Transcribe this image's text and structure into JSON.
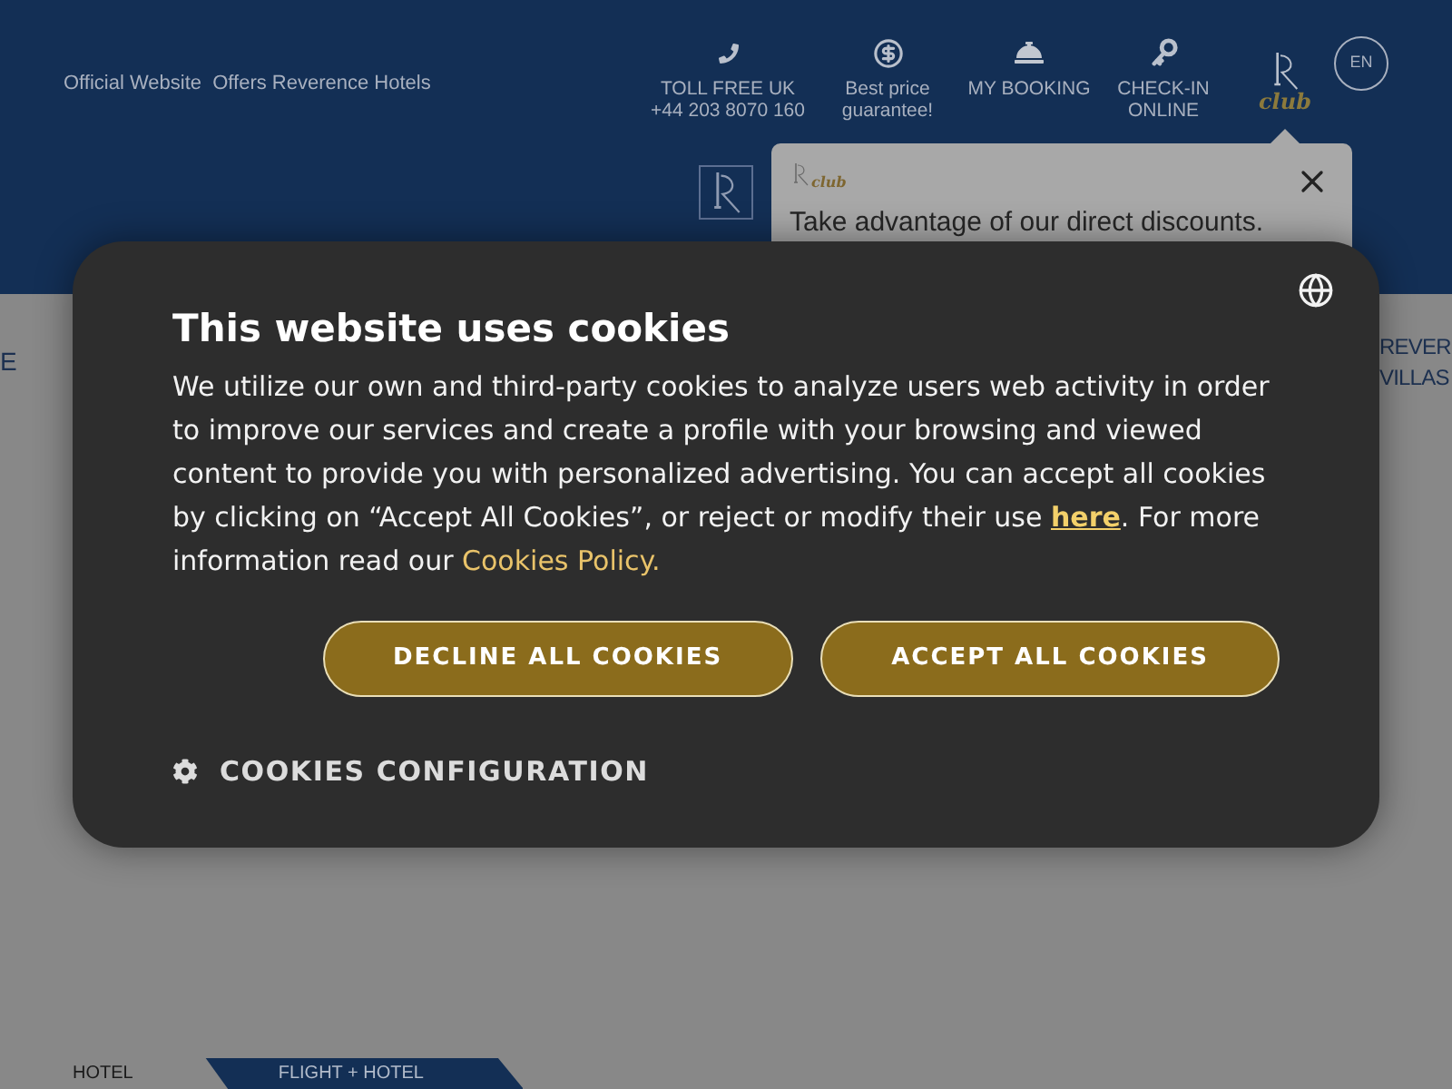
{
  "header": {
    "tagline": "Official Website  Offers Reverence Hotels",
    "links": [
      {
        "kind": "phone",
        "lines": [
          "TOLL FREE UK",
          "+44 203 8070 160"
        ]
      },
      {
        "kind": "price",
        "lines": [
          "Best price",
          "guarantee!"
        ]
      },
      {
        "kind": "booking",
        "lines": [
          "MY BOOKING"
        ]
      },
      {
        "kind": "checkin",
        "lines": [
          "CHECK-IN",
          "ONLINE"
        ]
      }
    ],
    "club_logo": "club",
    "language": "EN"
  },
  "club_popup": {
    "logo_text": "club",
    "message": "Take advantage of our direct discounts."
  },
  "nav": {
    "left_fragment": "E",
    "right_fragment": [
      "REVER",
      "VILLAS"
    ]
  },
  "booking_tabs": [
    {
      "label": "HOTEL",
      "selected": false
    },
    {
      "label": "FLIGHT + HOTEL",
      "selected": true
    }
  ],
  "cookie_dialog": {
    "title": "This website uses cookies",
    "text": [
      {
        "kind": "text",
        "text": "We utilize our own and third-party cookies to analyze users web activity in order to improve our services and create a profile with your browsing and viewed content to provide you with personalized advertising. You can accept all cookies by clicking on “Accept All Cookies”, or reject or modify their use "
      },
      {
        "kind": "inline_link",
        "text": "here"
      },
      {
        "kind": "text",
        "text": ". For more information read our "
      },
      {
        "kind": "policy_link",
        "text": "Cookies Policy."
      }
    ],
    "buttons": [
      "DECLINE ALL COOKIES",
      "ACCEPT ALL COOKIES"
    ],
    "configuration": "COOKIES CONFIGURATION"
  }
}
